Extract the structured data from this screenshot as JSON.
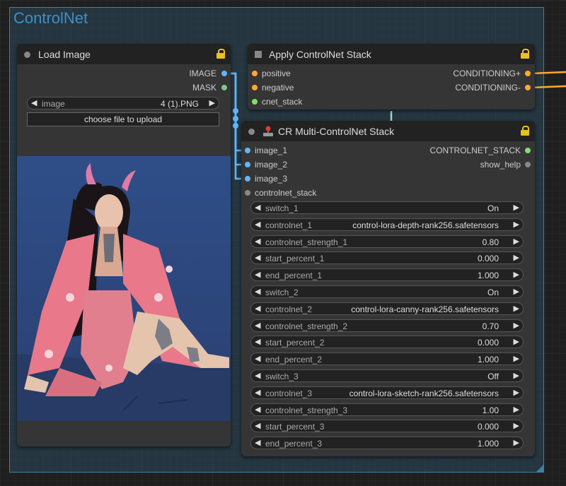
{
  "group": {
    "title": "ControlNet"
  },
  "load_image": {
    "title": "Load Image",
    "outputs": [
      "IMAGE",
      "MASK"
    ],
    "image_widget": {
      "label": "image",
      "value": "4 (1).PNG"
    },
    "upload_label": "choose file to upload"
  },
  "apply_stack": {
    "title": "Apply ControlNet Stack",
    "inputs": [
      "positive",
      "negative",
      "cnet_stack"
    ],
    "outputs": [
      "CONDITIONING+",
      "CONDITIONING-"
    ]
  },
  "multi_stack": {
    "title": "CR Multi-ControlNet Stack",
    "inputs": [
      "image_1",
      "image_2",
      "image_3",
      "controlnet_stack"
    ],
    "outputs": [
      "CONTROLNET_STACK",
      "show_help"
    ],
    "widgets": [
      {
        "label": "switch_1",
        "value": "On"
      },
      {
        "label": "controlnet_1",
        "value": "control-lora-depth-rank256.safetensors"
      },
      {
        "label": "controlnet_strength_1",
        "value": "0.80"
      },
      {
        "label": "start_percent_1",
        "value": "0.000"
      },
      {
        "label": "end_percent_1",
        "value": "1.000"
      },
      {
        "label": "switch_2",
        "value": "On"
      },
      {
        "label": "controlnet_2",
        "value": "control-lora-canny-rank256.safetensors"
      },
      {
        "label": "controlnet_strength_2",
        "value": "0.70"
      },
      {
        "label": "start_percent_2",
        "value": "0.000"
      },
      {
        "label": "end_percent_2",
        "value": "1.000"
      },
      {
        "label": "switch_3",
        "value": "Off"
      },
      {
        "label": "controlnet_3",
        "value": "control-lora-sketch-rank256.safetensors"
      },
      {
        "label": "controlnet_strength_3",
        "value": "1.00"
      },
      {
        "label": "start_percent_3",
        "value": "0.000"
      },
      {
        "label": "end_percent_3",
        "value": "1.000"
      }
    ]
  },
  "colors": {
    "image_slot": "#64b5f6",
    "mask_slot": "#81c784",
    "conditioning_slot": "#ffa931",
    "stack_slot": "#7fe06b",
    "lock": "#e8c220",
    "group_border": "#3f7fa6"
  }
}
